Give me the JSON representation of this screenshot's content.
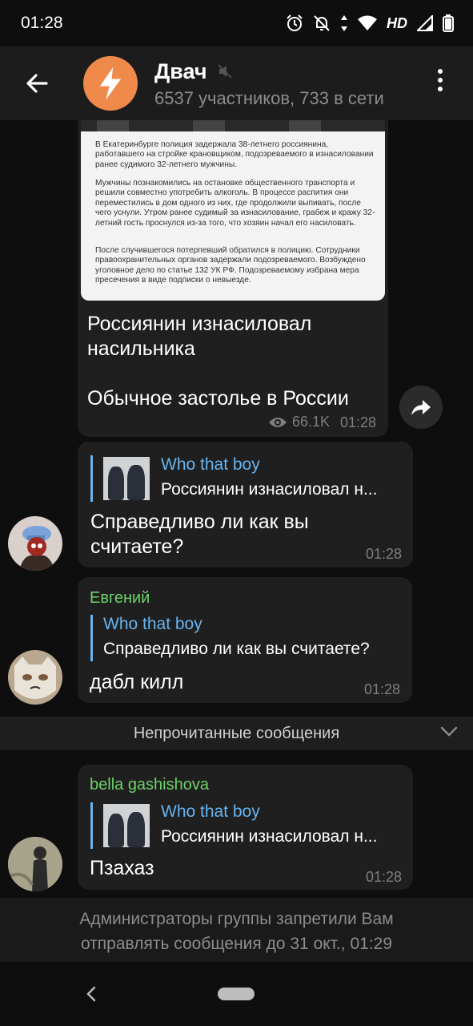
{
  "status_bar": {
    "time": "01:28",
    "network": "HD"
  },
  "header": {
    "title": "Двач",
    "subtitle": "6537 участников, 733 в сети"
  },
  "post": {
    "image_text": [
      "В Екатеринбурге полиция задержала 38-летнего россиянина, работавшего на стройке крановщиком, подозреваемого в изнасиловании ранее судимого 32-летнего мужчины.",
      "Мужчины познакомились на остановке общественного транспорта и решили совместно употребить алкоголь. В процессе распития они переместились в дом одного из них, где продолжили выпивать, после чего уснули. Утром ранее судимый за изнасилование, грабеж и кражу 32-летний гость проснулся из-за того, что хозяин начал его насиловать.",
      "После случившегося потерпевший обратился в полицию. Сотрудники правоохранительных органов задержали подозреваемого. Возбуждено уголовное дело по статье 132 УК РФ. Подозреваемому избрана мера пресечения в виде подписки о невыезде."
    ],
    "text_line1": "Россиянин изнасиловал",
    "text_line2": "насильника",
    "text_line3": "Обычное застолье в России",
    "views": "66.1K",
    "time": "01:28"
  },
  "messages": [
    {
      "reply_name": "Who that boy",
      "reply_text": "Россиянин изнасиловал н...",
      "text_line1": "Справедливо ли как вы",
      "text_line2": "считаете?",
      "time": "01:28"
    },
    {
      "sender": "Евгений",
      "reply_name": "Who that boy",
      "reply_text": "Справедливо ли как вы считаете?",
      "text": "дабл килл",
      "time": "01:28"
    },
    {
      "sender": "bella gashishova",
      "reply_name": "Who that boy",
      "reply_text": "Россиянин изнасиловал н...",
      "text": "Пзахаз",
      "time": "01:28"
    }
  ],
  "unread_label": "Непрочитанные сообщения",
  "restriction": {
    "line1": "Администраторы группы запретили Вам",
    "line2": "отправлять сообщения до 31 окт., 01:29"
  },
  "colors": {
    "accent_blue": "#67b4f0",
    "sender_green": "#6cd26a",
    "avatar_orange": "#f08a4b",
    "bubble": "#1f1f1f"
  }
}
